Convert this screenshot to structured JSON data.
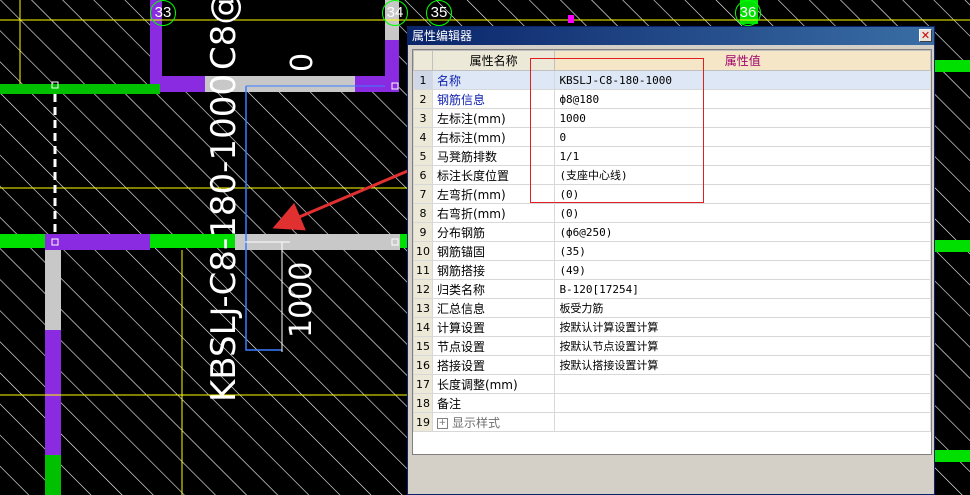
{
  "drawing": {
    "grid_labels": [
      "33",
      "34",
      "35",
      "36"
    ],
    "main_label": "KBSLJ-C8-180-1000",
    "top_label": "C8@",
    "zero_label": "0",
    "dim_label": "1000"
  },
  "editor": {
    "title": "属性编辑器",
    "close": "✕",
    "headers": {
      "name": "属性名称",
      "value": "属性值"
    },
    "rows": [
      {
        "idx": "1",
        "name": "名称",
        "value": "KBSLJ-C8-180-1000",
        "style": "blue"
      },
      {
        "idx": "2",
        "name": "钢筋信息",
        "value": "ф8@180",
        "style": "blue"
      },
      {
        "idx": "3",
        "name": "左标注(mm)",
        "value": "1000",
        "style": ""
      },
      {
        "idx": "4",
        "name": "右标注(mm)",
        "value": "0",
        "style": ""
      },
      {
        "idx": "5",
        "name": "马凳筋排数",
        "value": "1/1",
        "style": ""
      },
      {
        "idx": "6",
        "name": "标注长度位置",
        "value": "(支座中心线)",
        "style": ""
      },
      {
        "idx": "7",
        "name": "左弯折(mm)",
        "value": "(0)",
        "style": ""
      },
      {
        "idx": "8",
        "name": "右弯折(mm)",
        "value": "(0)",
        "style": ""
      },
      {
        "idx": "9",
        "name": "分布钢筋",
        "value": "(ф6@250)",
        "style": ""
      },
      {
        "idx": "10",
        "name": "钢筋锚固",
        "value": "(35)",
        "style": ""
      },
      {
        "idx": "11",
        "name": "钢筋搭接",
        "value": "(49)",
        "style": ""
      },
      {
        "idx": "12",
        "name": "归类名称",
        "value": "B-120[17254]",
        "style": ""
      },
      {
        "idx": "13",
        "name": "汇总信息",
        "value": "板受力筋",
        "style": ""
      },
      {
        "idx": "14",
        "name": "计算设置",
        "value": "按默认计算设置计算",
        "style": ""
      },
      {
        "idx": "15",
        "name": "节点设置",
        "value": "按默认节点设置计算",
        "style": ""
      },
      {
        "idx": "16",
        "name": "搭接设置",
        "value": "按默认搭接设置计算",
        "style": ""
      },
      {
        "idx": "17",
        "name": "长度调整(mm)",
        "value": "",
        "style": ""
      },
      {
        "idx": "18",
        "name": "备注",
        "value": "",
        "style": ""
      },
      {
        "idx": "19",
        "name": "显示样式",
        "value": "",
        "style": "gray",
        "expander": "+"
      }
    ]
  },
  "colors": {
    "highlight_box": "#e02020",
    "arrow": "#e03030",
    "beam_green": "#00e000",
    "beam_purple": "#8a2be2"
  }
}
